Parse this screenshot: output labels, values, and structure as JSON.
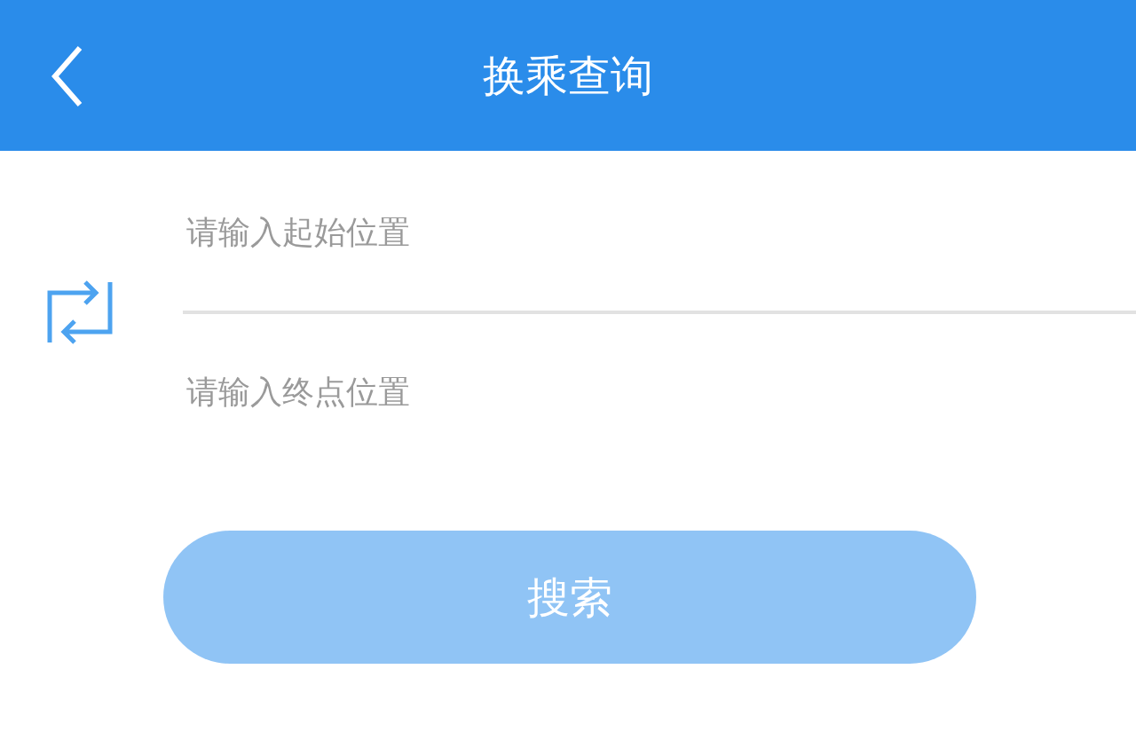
{
  "header": {
    "title": "换乘查询"
  },
  "fields": [
    {
      "placeholder": "请输入起始位置"
    },
    {
      "placeholder": "请输入终点位置"
    }
  ],
  "search_button": {
    "label": "搜索",
    "disabled": true
  }
}
